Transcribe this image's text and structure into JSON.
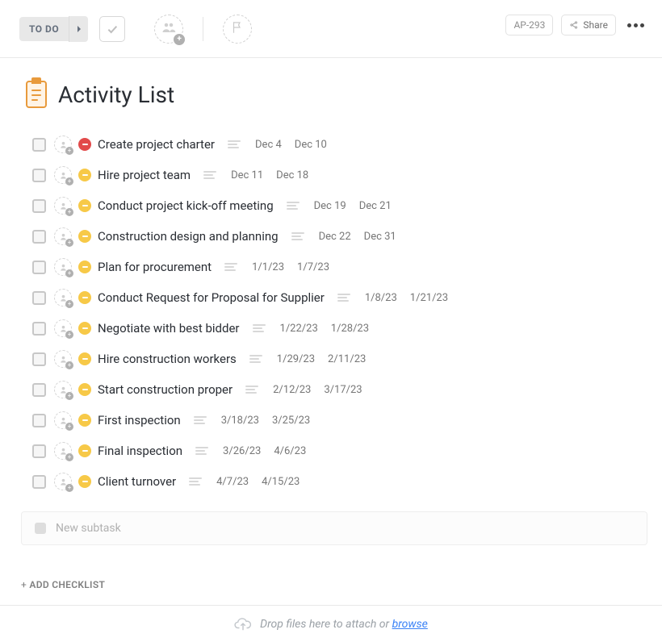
{
  "header": {
    "status_label": "TO DO",
    "ticket_id": "AP-293",
    "share_label": "Share"
  },
  "page": {
    "title": "Activity List"
  },
  "tasks": [
    {
      "priority": "red",
      "name": "Create project charter",
      "start": "Dec 4",
      "end": "Dec 10"
    },
    {
      "priority": "yel",
      "name": "Hire project team",
      "start": "Dec 11",
      "end": "Dec 18"
    },
    {
      "priority": "yel",
      "name": "Conduct project kick-off meeting",
      "start": "Dec 19",
      "end": "Dec 21"
    },
    {
      "priority": "yel",
      "name": "Construction design and planning",
      "start": "Dec 22",
      "end": "Dec 31"
    },
    {
      "priority": "yel",
      "name": "Plan for procurement",
      "start": "1/1/23",
      "end": "1/7/23"
    },
    {
      "priority": "yel",
      "name": "Conduct Request for Proposal for Supplier",
      "start": "1/8/23",
      "end": "1/21/23"
    },
    {
      "priority": "yel",
      "name": "Negotiate with best bidder",
      "start": "1/22/23",
      "end": "1/28/23"
    },
    {
      "priority": "yel",
      "name": "Hire construction workers",
      "start": "1/29/23",
      "end": "2/11/23"
    },
    {
      "priority": "yel",
      "name": "Start construction proper",
      "start": "2/12/23",
      "end": "3/17/23"
    },
    {
      "priority": "yel",
      "name": "First inspection",
      "start": "3/18/23",
      "end": "3/25/23"
    },
    {
      "priority": "yel",
      "name": "Final inspection",
      "start": "3/26/23",
      "end": "4/6/23"
    },
    {
      "priority": "yel",
      "name": "Client turnover",
      "start": "4/7/23",
      "end": "4/15/23"
    }
  ],
  "newtask": {
    "placeholder": "New subtask"
  },
  "checklist": {
    "add_label": "ADD CHECKLIST"
  },
  "dropzone": {
    "text": "Drop files here to attach or ",
    "link": "browse"
  }
}
